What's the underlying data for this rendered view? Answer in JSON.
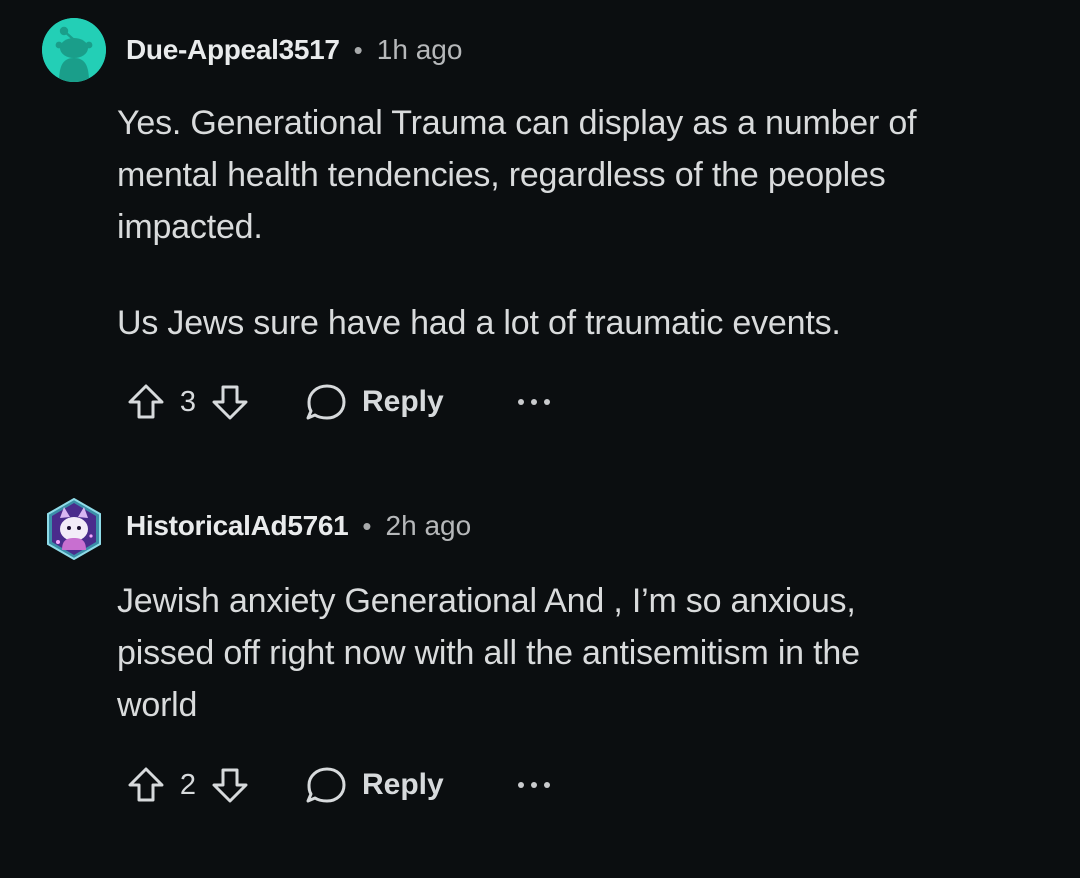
{
  "comments": [
    {
      "username": "Due-Appeal3517",
      "separator": "•",
      "time": "1h ago",
      "avatar_icon": "snoo-avatar-icon",
      "avatar_color": "#23cfb6",
      "paragraphs": [
        "Yes. Generational Trauma can display as a number of\nmental health tendencies, regardless of the peoples\nimpacted.",
        "Us Jews sure have had a lot of traumatic events."
      ],
      "score": "3",
      "reply_label": "Reply"
    },
    {
      "username": "HistoricalAd5761",
      "separator": "•",
      "time": "2h ago",
      "avatar_icon": "ghost-cat-avatar-icon",
      "avatar_color": "#7a4fc2",
      "paragraphs": [
        "Jewish anxiety Generational And , I’m so anxious,\npissed off right now with all the antisemitism in the\nworld"
      ],
      "score": "2",
      "reply_label": "Reply"
    }
  ],
  "icons": {
    "upvote": "upvote-arrow-icon",
    "downvote": "downvote-arrow-icon",
    "reply": "speech-bubble-icon",
    "more": "ellipsis-icon"
  },
  "colors": {
    "background": "#0b0e10",
    "text": "#d7dadc",
    "meta": "#b6b8ba"
  }
}
